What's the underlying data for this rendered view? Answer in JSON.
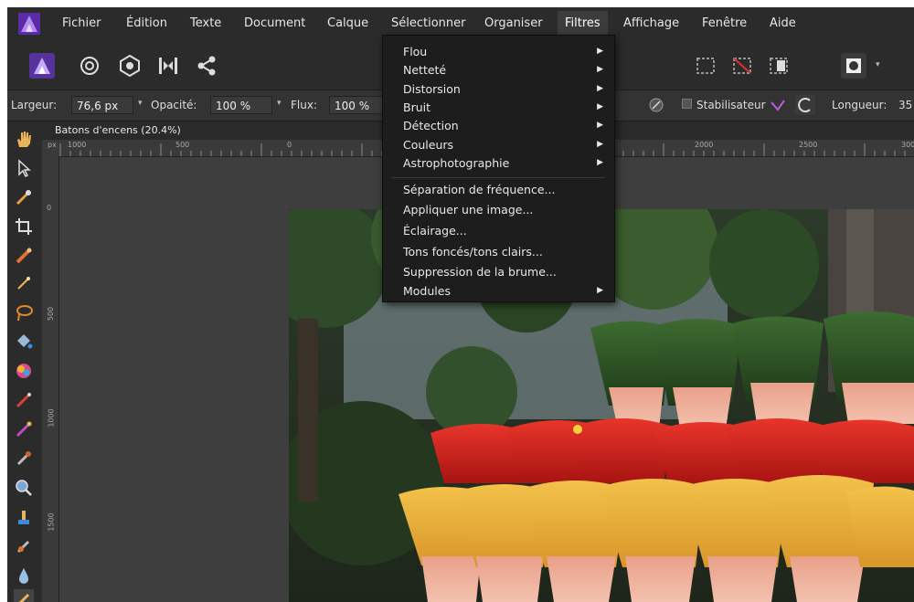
{
  "menubar": {
    "items": [
      "Fichier",
      "Édition",
      "Texte",
      "Document",
      "Calque",
      "Sélectionner",
      "Organiser",
      "Filtres",
      "Affichage",
      "Fenêtre",
      "Aide"
    ],
    "active": "Filtres"
  },
  "context": {
    "largeur_label": "Largeur:",
    "largeur_value": "76,6 px",
    "opacite_label": "Opacité:",
    "opacite_value": "100 %",
    "flux_label": "Flux:",
    "flux_value": "100 %",
    "stabilisateur_label": "Stabilisateur",
    "longueur_label": "Longueur:",
    "longueur_value": "35"
  },
  "document": {
    "tab_title": "Batons d'encens (20.4%)",
    "hruler_labels": [
      "1000",
      "500",
      "0",
      "2000",
      "2500",
      "3000"
    ],
    "vruler_labels": [
      "0",
      "500",
      "1000",
      "1500"
    ]
  },
  "filters_menu": {
    "items": [
      {
        "label": "Flou",
        "submenu": true
      },
      {
        "label": "Netteté",
        "submenu": true
      },
      {
        "label": "Distorsion",
        "submenu": true
      },
      {
        "label": "Bruit",
        "submenu": true
      },
      {
        "label": "Détection",
        "submenu": true
      },
      {
        "label": "Couleurs",
        "submenu": true
      },
      {
        "label": "Astrophotographie",
        "submenu": true
      },
      {
        "label": "Séparation de fréquence...",
        "submenu": false
      },
      {
        "label": "Appliquer une image...",
        "submenu": false
      },
      {
        "label": "Éclairage...",
        "submenu": false
      },
      {
        "label": "Tons foncés/tons clairs...",
        "submenu": false
      },
      {
        "label": "Suppression de la brume...",
        "submenu": false
      },
      {
        "label": "Modules",
        "submenu": true
      }
    ]
  },
  "icons": {
    "app_logo": "affinity-photo-logo",
    "submenu_arrow": "▸"
  },
  "colors": {
    "accent": "#7b3fd1",
    "menu_bg": "#1d1d1d",
    "ui_bg": "#2b2b2b"
  }
}
